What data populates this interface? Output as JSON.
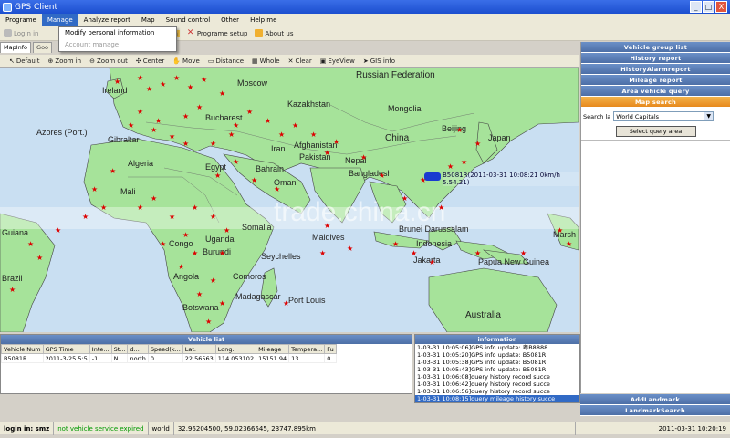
{
  "window": {
    "title": "GPS Client",
    "buttons": [
      "_",
      "□",
      "X"
    ]
  },
  "menu": [
    "Programe",
    "Manage",
    "Analyze report",
    "Map",
    "Sound control",
    "Other",
    "Help me"
  ],
  "manage_dropdown": [
    "Modify personal information",
    "Account manage"
  ],
  "toolbar1": [
    {
      "label": "Login in",
      "icon": "login-icon",
      "enabled": false
    },
    {
      "label": "form",
      "icon": "form-icon",
      "enabled": true
    },
    {
      "label": "Programe setup",
      "icon": "setup-icon",
      "enabled": true
    },
    {
      "label": "About us",
      "icon": "about-icon",
      "enabled": true
    }
  ],
  "tabs": [
    "MapInfo",
    "Goo"
  ],
  "map_tools": [
    "Default",
    "Zoom in",
    "Zoom out",
    "Center",
    "Move",
    "Distance",
    "Whole",
    "Clear",
    "EyeView",
    "GIS info"
  ],
  "map_labels": [
    "Russian Federation",
    "Moscow",
    "Kazakhstan",
    "Mongolia",
    "Ireland",
    "Azores (Port.)",
    "Gibraltar",
    "Bucharest",
    "Beijing",
    "Japan",
    "China",
    "Algeria",
    "Egypt",
    "Iran",
    "Afghanistan",
    "Pakistan",
    "Nepal",
    "Bangladesh",
    "Bahrain",
    "Oman",
    "Mali",
    "Maldives",
    "Somalia",
    "Guiana",
    "Congo",
    "Uganda",
    "Burundi",
    "Seychelles",
    "Angola",
    "Comoros",
    "Madagascar",
    "Port Louis",
    "Botswana",
    "Brazil",
    "Brunei Darussalam",
    "Indonesia",
    "Jakarta",
    "Papua New Guinea",
    "Australia",
    "Marsh"
  ],
  "vehicle_marker_label": "B5081R(2011-03-31 10:08:21 0km/h 5.54.21)",
  "watermark": "trade.china.cn",
  "right_panel": {
    "titles_top": [
      "Vehicle group list",
      "History report",
      "HistoryAlarmreport",
      "Mileage report",
      "Area vehicle query",
      "Map search"
    ],
    "search_label": "Search la",
    "search_value": "World Capitals",
    "query_button": "Select query area",
    "titles_bottom": [
      "AddLandmark",
      "LandmarkSearch"
    ]
  },
  "vehicle_list": {
    "title": "Vehicle list",
    "columns": [
      "Vehicle Num",
      "GPS Time",
      "Inte...",
      "St...",
      "d...",
      "Speed(k...",
      "Lat.",
      "Long.",
      "Mileage",
      "Tempera...",
      "Fu"
    ],
    "rows": [
      [
        "B5081R",
        "2011-3-25 5:5",
        "-1",
        "N",
        "north",
        "0",
        "22.56563",
        "114.053102",
        "15151.94",
        "13",
        "0"
      ]
    ]
  },
  "information": {
    "title": "information",
    "lines": [
      "1-03-31 10:05:06]GPS info update: 粤B8888",
      "1-03-31 10:05:20]GPS info update: B5081R",
      "1-03-31 10:05:38]GPS info update: B5081R",
      "1-03-31 10:05:43]GPS info update: B5081R",
      "1-03-31 10:06:08]query history record succe",
      "1-03-31 10:06:42]query history record succe",
      "1-03-31 10:06:56]query history record succe",
      "1-03-31 10:08:15]query mileage history succe"
    ]
  },
  "status": {
    "login": "login in: smz",
    "warning": "not vehicle  service expired",
    "layer": "world",
    "coords": "32.96204500, 59.02366545, 23747.895km",
    "datetime": "2011-03-31  10:20:19"
  },
  "colors": {
    "accent_blue": "#4d6fa6",
    "active_orange": "#e7891d",
    "ocean": "#c9dff2",
    "land": "#a6e39a",
    "star": "#dd0000"
  }
}
